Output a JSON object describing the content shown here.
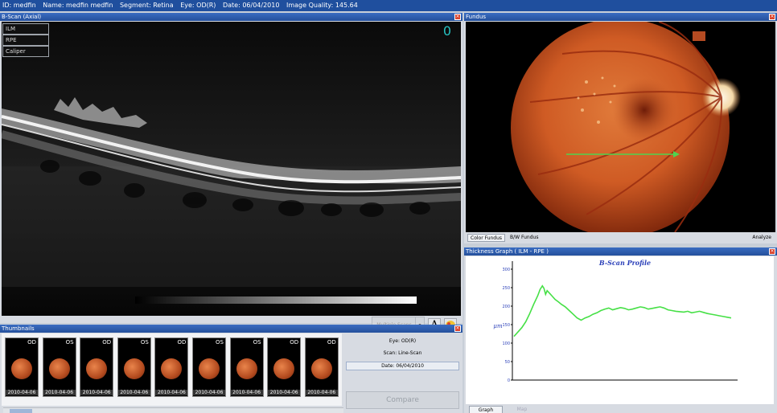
{
  "header": {
    "id": "ID: medfin",
    "name": "Name: medfin medfin",
    "segment": "Segment: Retina",
    "eye": "Eye: OD(R)",
    "date": "Date: 06/04/2010",
    "quality": "Image Quality: 145.64"
  },
  "bscan": {
    "title": "B-Scan (Axial)",
    "overlays": [
      "ILM",
      "RPE",
      "Caliper"
    ],
    "frame_counter": "0",
    "multiscan_label": "Multiple Scans",
    "font_button": "A"
  },
  "fundus": {
    "title": "Fundus",
    "tabs": [
      "Color Fundus",
      "B/W Fundus",
      "Analyze"
    ]
  },
  "thickness": {
    "title": "Thickness Graph ( ILM - RPE )",
    "tabs": [
      "Graph",
      "Map"
    ],
    "chart_data": {
      "type": "line",
      "title": "B-Scan Profile",
      "ylabel": "μm",
      "ylim": [
        0,
        300
      ],
      "yticks": [
        "0",
        "50",
        "100",
        "150",
        "200",
        "250",
        "300"
      ],
      "x": [
        0,
        5,
        10,
        15,
        20,
        25,
        30,
        33,
        36,
        38,
        40,
        42,
        45,
        48,
        52,
        56,
        60,
        65,
        70,
        75,
        80,
        85,
        90,
        95,
        100,
        105,
        110,
        115,
        120,
        125,
        130,
        135,
        140,
        145,
        150,
        155,
        160,
        165,
        170,
        175,
        180,
        185,
        190,
        195,
        200,
        205,
        210,
        215,
        220,
        225,
        230,
        235,
        240,
        245,
        250,
        255,
        260,
        265,
        270,
        275
      ],
      "series": [
        {
          "values": [
            118,
            130,
            142,
            158,
            180,
            205,
            228,
            245,
            255,
            248,
            232,
            242,
            235,
            228,
            218,
            212,
            205,
            198,
            188,
            178,
            168,
            162,
            168,
            172,
            178,
            182,
            188,
            192,
            195,
            190,
            193,
            196,
            194,
            190,
            192,
            195,
            198,
            196,
            192,
            194,
            196,
            198,
            195,
            190,
            188,
            186,
            185,
            184,
            186,
            182,
            184,
            186,
            183,
            180,
            178,
            176,
            174,
            172,
            170,
            168
          ]
        }
      ]
    }
  },
  "thumbnails": {
    "title": "Thumbnails",
    "items": [
      {
        "eye": "OD",
        "date": "2010-04-06"
      },
      {
        "eye": "OS",
        "date": "2010-04-06"
      },
      {
        "eye": "OD",
        "date": "2010-04-06"
      },
      {
        "eye": "OS",
        "date": "2010-04-06"
      },
      {
        "eye": "OD",
        "date": "2010-04-06"
      },
      {
        "eye": "OS",
        "date": "2010-04-06"
      },
      {
        "eye": "OS",
        "date": "2010-04-06"
      },
      {
        "eye": "OD",
        "date": "2010-04-06"
      },
      {
        "eye": "OD",
        "date": "2010-04-06"
      }
    ],
    "info": {
      "eye": "Eye: OD(R)",
      "scan": "Scan: Line-Scan",
      "date": "Date: 06/04/2010",
      "compare_label": "Compare"
    }
  }
}
